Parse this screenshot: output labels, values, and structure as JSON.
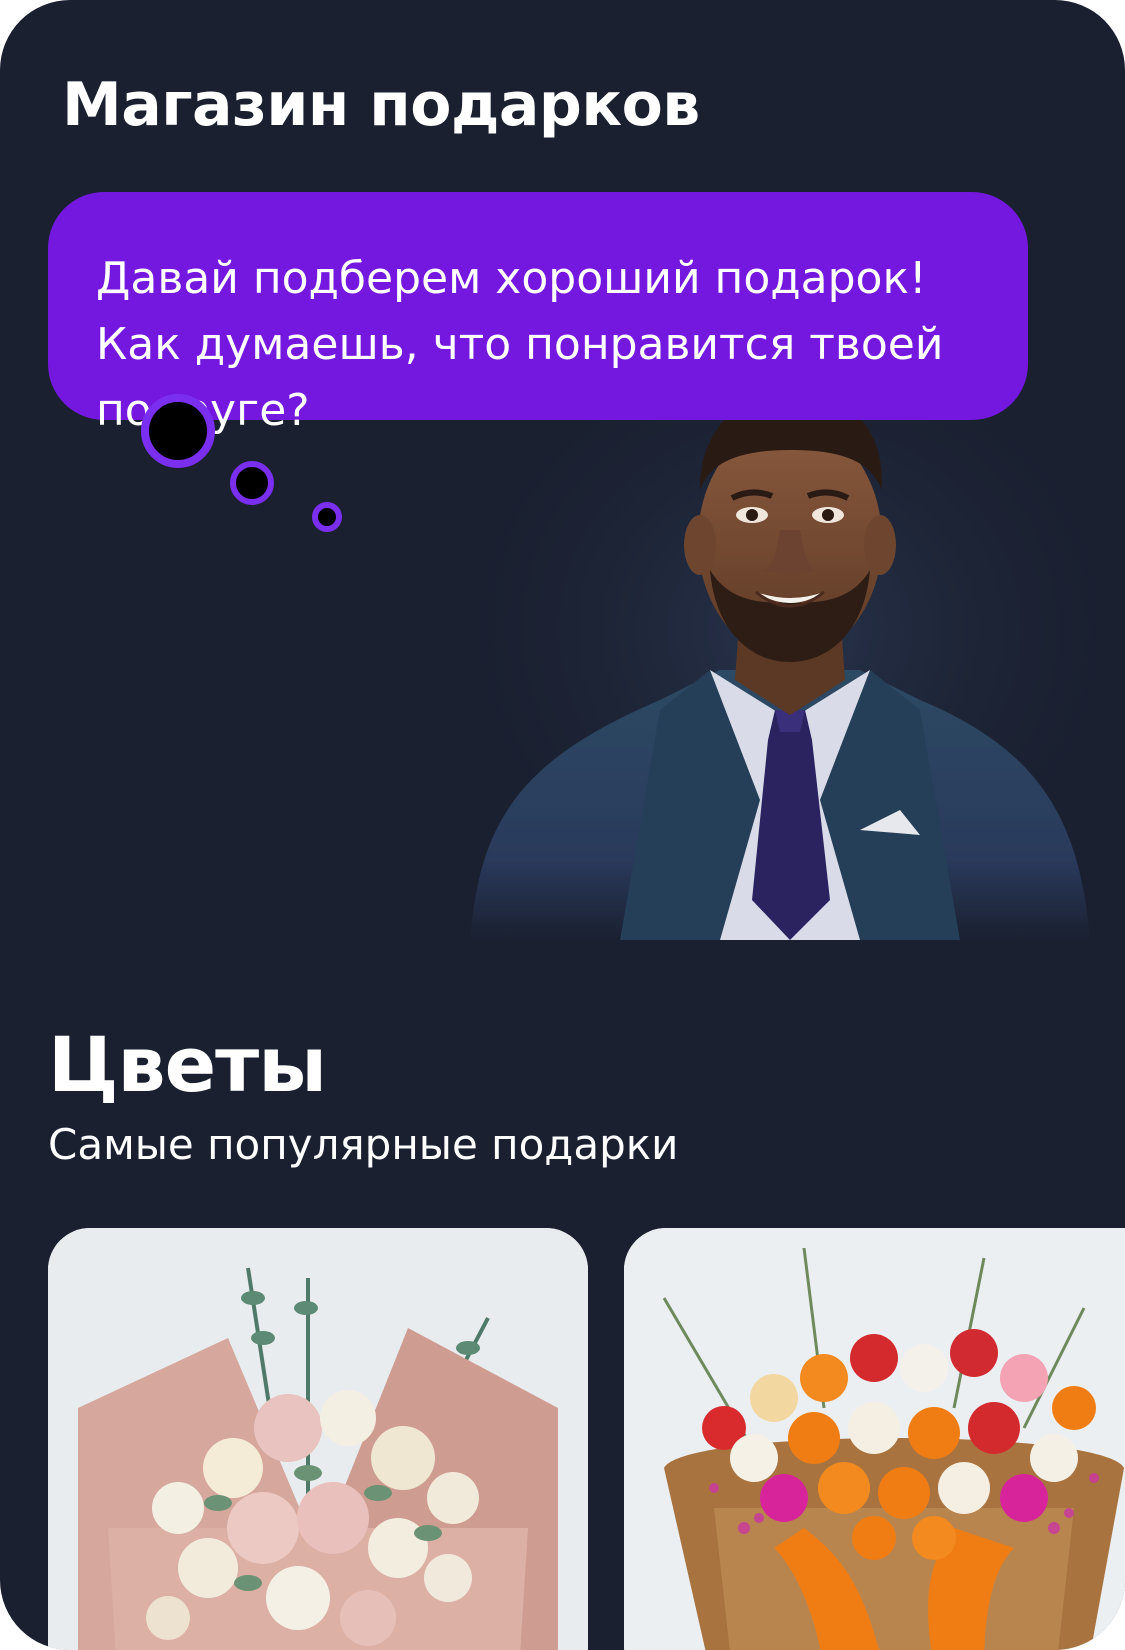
{
  "header": {
    "title": "Магазин подарков"
  },
  "assistant": {
    "message": "Давай подберем хороший подарок! Как думаешь, что понравится твоей подруге?",
    "avatar": "assistant-avatar-man-in-suit"
  },
  "section": {
    "title": "Цветы",
    "subtitle": "Самые популярные подарки"
  },
  "products": [
    {
      "image": "bouquet-pink-roses-eustoma"
    },
    {
      "image": "bouquet-orange-red-roses"
    }
  ],
  "colors": {
    "background": "#1a2030",
    "bubble": "#7418e0",
    "text": "#ffffff",
    "accent_ring": "#7a2ef0"
  }
}
